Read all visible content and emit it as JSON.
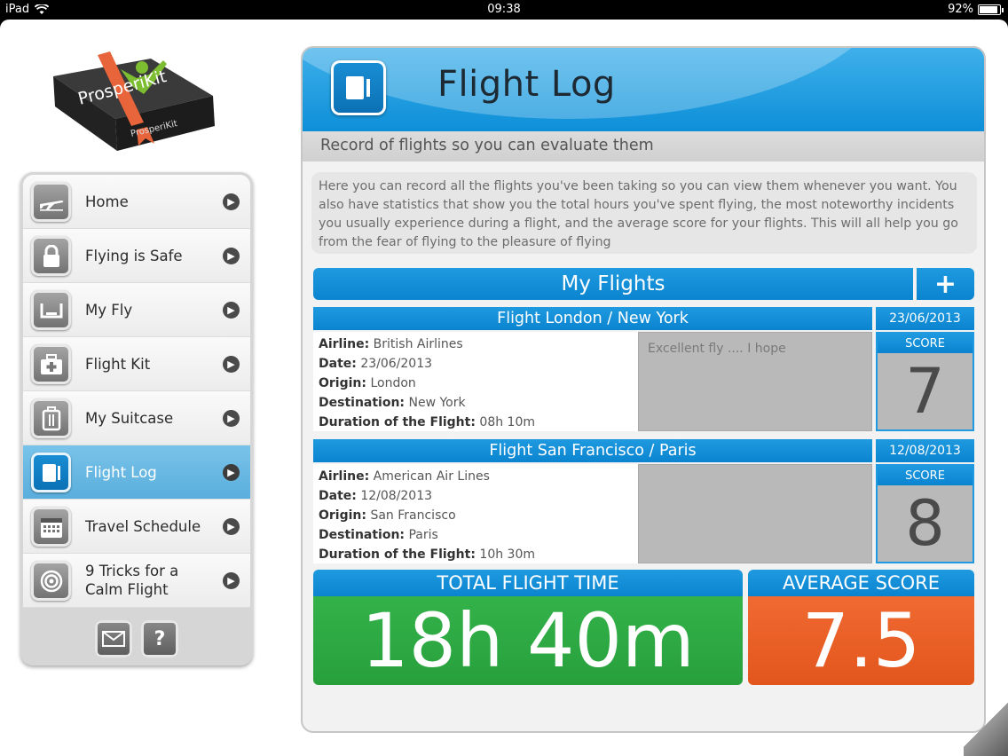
{
  "status_bar": {
    "device": "iPad",
    "time": "09:38",
    "battery": "92%",
    "battery_level": 0.92
  },
  "logo": {
    "brand_top": "ProsperiKit",
    "brand_side": "ProsperiKit"
  },
  "sidebar": {
    "items": [
      {
        "label": "Home",
        "icon": "airplane-icon",
        "active": false
      },
      {
        "label": "Flying is Safe",
        "icon": "lock-icon",
        "active": false
      },
      {
        "label": "My Fly",
        "icon": "seat-icon",
        "active": false
      },
      {
        "label": "Flight Kit",
        "icon": "first-aid-kit-icon",
        "active": false
      },
      {
        "label": "My Suitcase",
        "icon": "suitcase-icon",
        "active": false
      },
      {
        "label": "Flight Log",
        "icon": "notebook-icon",
        "active": true
      },
      {
        "label": "Travel Schedule",
        "icon": "calendar-icon",
        "active": false
      },
      {
        "label": "9 Tricks for a Calm Flight",
        "icon": "target-icon",
        "active": false
      }
    ],
    "footer": {
      "mail_icon": "mail-icon",
      "help_label": "?"
    }
  },
  "header": {
    "title": "Flight Log",
    "subtitle": "Record of flights so you can evaluate them"
  },
  "description": "Here you can record all the flights you've been taking so you can view them whenever you want. You also have statistics that show you the total hours you've spent flying, the most noteworthy incidents you usually experience during a flight, and the average score for your flights. This will all help you go from the fear of flying to the pleasure of flying",
  "my_flights": {
    "title": "My Flights",
    "add_label": "+"
  },
  "field_labels": {
    "airline": "Airline:",
    "date": "Date:",
    "origin": "Origin:",
    "destination": "Destination:",
    "duration": "Duration of the Flight:",
    "score": "SCORE"
  },
  "flights": [
    {
      "title": "Flight London / New York",
      "date": "23/06/2013",
      "airline": "British Airlines",
      "date_detail": "23/06/2013",
      "origin": "London",
      "destination": "New York",
      "duration": "08h 10m",
      "notes": "Excellent fly .... I hope",
      "score": "7"
    },
    {
      "title": "Flight San Francisco / Paris",
      "date": "12/08/2013",
      "airline": "American Air Lines",
      "date_detail": "12/08/2013",
      "origin": "San Francisco",
      "destination": "Paris",
      "duration": "10h 30m",
      "notes": "",
      "score": "8"
    }
  ],
  "stats": {
    "total_label": "TOTAL FLIGHT TIME",
    "total_value": "18h 40m",
    "avg_label": "AVERAGE SCORE",
    "avg_value": "7.5"
  },
  "colors": {
    "accent_blue": "#0a84cf",
    "active_item": "#5aaedc",
    "green": "#27a03c",
    "orange": "#e2561c"
  }
}
